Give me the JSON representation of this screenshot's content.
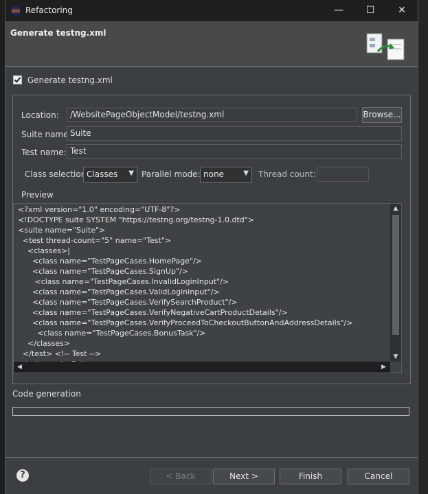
{
  "window": {
    "title": "Refactoring",
    "controls": {
      "minimize": "—",
      "maximize": "☐",
      "close": "✕"
    }
  },
  "header": {
    "title": "Generate testng.xml"
  },
  "generate_checkbox": {
    "label": "Generate testng.xml",
    "checked": true
  },
  "form": {
    "location_label": "Location:",
    "location_value": "/WebsitePageObjectModel/testng.xml",
    "browse_label": "Browse...",
    "suite_label": "Suite name:",
    "suite_value": "Suite",
    "test_label": "Test name:",
    "test_value": "Test",
    "class_selection_label": "Class selection:",
    "class_selection_value": "Classes",
    "parallel_label": "Parallel mode:",
    "parallel_value": "none",
    "thread_label": "Thread count:",
    "thread_value": ""
  },
  "preview": {
    "label": "Preview",
    "lines": [
      "<?xml version=\"1.0\" encoding=\"UTF-8\"?>",
      "<!DOCTYPE suite SYSTEM \"https://testng.org/testng-1.0.dtd\">",
      "<suite name=\"Suite\">",
      "  <test thread-count=\"5\" name=\"Test\">",
      "    <classes>|",
      "      <class name=\"TestPageCases.HomePage\"/>",
      "      <class name=\"TestPageCases.SignUp\"/>",
      "       <class name=\"TestPageCases.InvalidLoginInput\"/>",
      "      <class name=\"TestPageCases.ValidLoginInput\"/>",
      "      <class name=\"TestPageCases.VerifySearchProduct\"/>",
      "      <class name=\"TestPageCases.VerifyNegativeCartProductDetails\"/>",
      "      <class name=\"TestPageCases.VerifyProceedToCheckoutButtonAndAddressDetails\"/>",
      "        <class name=\"TestPageCases.BonusTask\"/>",
      "    </classes>",
      "  </test> <!-- Test -->",
      "</suite> <!-- Suite -->"
    ]
  },
  "code_generation": {
    "label": "Code generation"
  },
  "footer": {
    "help": "?",
    "back": "< Back",
    "next": "Next >",
    "finish": "Finish",
    "cancel": "Cancel"
  }
}
